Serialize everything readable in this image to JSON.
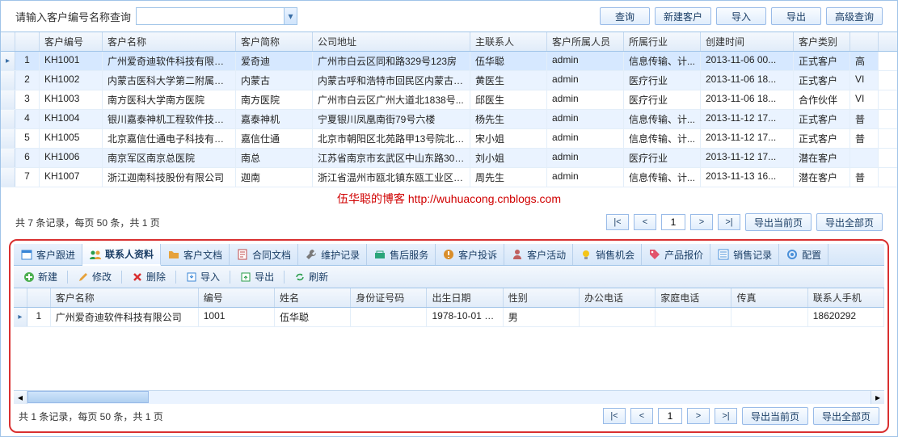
{
  "search": {
    "label": "请输入客户编号名称查询",
    "value": "",
    "btn_query": "查询",
    "btn_new": "新建客户",
    "btn_import": "导入",
    "btn_export": "导出",
    "btn_adv": "高级查询"
  },
  "main_grid": {
    "columns": [
      "客户编号",
      "客户名称",
      "客户简称",
      "公司地址",
      "主联系人",
      "客户所属人员",
      "所属行业",
      "创建时间",
      "客户类别",
      ""
    ],
    "widths": [
      78,
      165,
      95,
      195,
      95,
      95,
      95,
      115,
      70,
      35
    ],
    "rows": [
      {
        "n": 1,
        "id": "KH1001",
        "name": "广州爱奇迪软件科技有限公司",
        "abbr": "爱奇迪",
        "addr": "广州市白云区同和路329号123房",
        "contact": "伍华聪",
        "owner": "admin",
        "industry": "信息传输、计...",
        "created": "2013-11-06 00...",
        "type": "正式客户",
        "extra": "高"
      },
      {
        "n": 2,
        "id": "KH1002",
        "name": "内蒙古医科大学第二附属医院",
        "abbr": "内蒙古",
        "addr": "内蒙古呼和浩特市回民区内蒙古医...",
        "contact": "黄医生",
        "owner": "admin",
        "industry": "医疗行业",
        "created": "2013-11-06 18...",
        "type": "正式客户",
        "extra": "VI"
      },
      {
        "n": 3,
        "id": "KH1003",
        "name": "南方医科大学南方医院",
        "abbr": "南方医院",
        "addr": "广州市白云区广州大道北1838号...",
        "contact": "邱医生",
        "owner": "admin",
        "industry": "医疗行业",
        "created": "2013-11-06 18...",
        "type": "合作伙伴",
        "extra": "VI"
      },
      {
        "n": 4,
        "id": "KH1004",
        "name": "银川嘉泰神机工程软件技术...",
        "abbr": "嘉泰神机",
        "addr": "宁夏银川凤凰南街79号六楼",
        "contact": "杨先生",
        "owner": "admin",
        "industry": "信息传输、计...",
        "created": "2013-11-12 17...",
        "type": "正式客户",
        "extra": "普"
      },
      {
        "n": 5,
        "id": "KH1005",
        "name": "北京嘉信仕通电子科技有限...",
        "abbr": "嘉信仕通",
        "addr": "北京市朝阳区北苑路甲13号院北辰...",
        "contact": "宋小姐",
        "owner": "admin",
        "industry": "信息传输、计...",
        "created": "2013-11-12 17...",
        "type": "正式客户",
        "extra": "普"
      },
      {
        "n": 6,
        "id": "KH1006",
        "name": "南京军区南京总医院",
        "abbr": "南总",
        "addr": "江苏省南京市玄武区中山东路305号",
        "contact": "刘小姐",
        "owner": "admin",
        "industry": "医疗行业",
        "created": "2013-11-12 17...",
        "type": "潜在客户",
        "extra": ""
      },
      {
        "n": 7,
        "id": "KH1007",
        "name": "浙江迦南科技股份有限公司",
        "abbr": "迦南",
        "addr": "浙江省温州市瓯北镇东瓯工业区园...",
        "contact": "周先生",
        "owner": "admin",
        "industry": "信息传输、计...",
        "created": "2013-11-13 16...",
        "type": "潜在客户",
        "extra": "普"
      }
    ]
  },
  "watermark": "伍华聪的博客 http://wuhuacong.cnblogs.com",
  "pager1": {
    "info": "共 7 条记录，每页 50 条，共 1 页",
    "page": "1",
    "first": "|<",
    "prev": "<",
    "next": ">",
    "last": ">|",
    "export_page": "导出当前页",
    "export_all": "导出全部页"
  },
  "tabs": [
    {
      "label": "客户跟进",
      "icon": "calendar",
      "color": "#3a86d6"
    },
    {
      "label": "联系人资料",
      "icon": "people",
      "color": "#2a9d4b",
      "active": true
    },
    {
      "label": "客户文档",
      "icon": "folder",
      "color": "#e6a23c"
    },
    {
      "label": "合同文档",
      "icon": "contract",
      "color": "#c04848"
    },
    {
      "label": "维护记录",
      "icon": "wrench",
      "color": "#7a7a7a"
    },
    {
      "label": "售后服务",
      "icon": "service",
      "color": "#2aa57a"
    },
    {
      "label": "客户投诉",
      "icon": "complaint",
      "color": "#d98e2b"
    },
    {
      "label": "客户活动",
      "icon": "activity",
      "color": "#c06060"
    },
    {
      "label": "销售机会",
      "icon": "bulb",
      "color": "#f5c518"
    },
    {
      "label": "产品报价",
      "icon": "tag",
      "color": "#e2526b"
    },
    {
      "label": "销售记录",
      "icon": "list",
      "color": "#4a90d9"
    }
  ],
  "tabs_config": "配置",
  "toolbar": {
    "new": "新建",
    "edit": "修改",
    "delete": "删除",
    "import": "导入",
    "export": "导出",
    "refresh": "刷新"
  },
  "detail_grid": {
    "columns": [
      "客户名称",
      "编号",
      "姓名",
      "身份证号码",
      "出生日期",
      "性别",
      "办公电话",
      "家庭电话",
      "传真",
      "联系人手机"
    ],
    "widths": [
      195,
      100,
      100,
      100,
      100,
      100,
      100,
      100,
      100,
      100
    ],
    "rows": [
      {
        "n": 1,
        "data": [
          "广州爱奇迪软件科技有限公司",
          "1001",
          "伍华聪",
          "",
          "1978-10-01 00...",
          "男",
          "",
          "",
          "",
          "18620292"
        ]
      }
    ]
  },
  "pager2": {
    "info": "共 1 条记录，每页 50 条，共 1 页",
    "page": "1",
    "first": "|<",
    "prev": "<",
    "next": ">",
    "last": ">|",
    "export_page": "导出当前页",
    "export_all": "导出全部页"
  }
}
